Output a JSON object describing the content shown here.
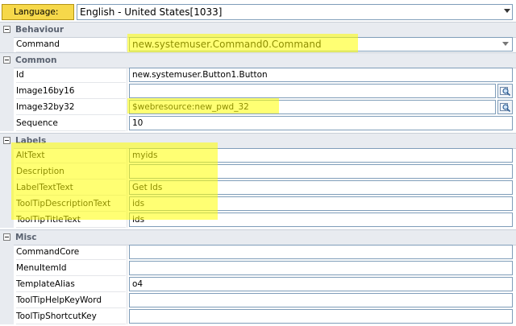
{
  "language": {
    "label": "Language:",
    "value": "English - United States[1033]"
  },
  "sections": {
    "behaviour": {
      "title": "Behaviour",
      "command": {
        "label": "Command",
        "value": "new.systemuser.Command0.Command"
      }
    },
    "common": {
      "title": "Common",
      "id": {
        "label": "Id",
        "value": "new.systemuser.Button1.Button"
      },
      "image16": {
        "label": "Image16by16",
        "value": ""
      },
      "image32": {
        "label": "Image32by32",
        "value": "$webresource:new_pwd_32"
      },
      "sequence": {
        "label": "Sequence",
        "value": "10"
      }
    },
    "labels": {
      "title": "Labels",
      "alttext": {
        "label": "AltText",
        "value": "myids"
      },
      "description": {
        "label": "Description",
        "value": ""
      },
      "labeltext": {
        "label": "LabelTextText",
        "value": "Get Ids"
      },
      "tooltipdesc": {
        "label": "ToolTipDescriptionText",
        "value": "ids"
      },
      "tooltiptitle": {
        "label": "ToolTipTitleText",
        "value": "ids"
      }
    },
    "misc": {
      "title": "Misc",
      "commandcore": {
        "label": "CommandCore",
        "value": ""
      },
      "menuitemid": {
        "label": "MenuItemId",
        "value": ""
      },
      "templatealias": {
        "label": "TemplateAlias",
        "value": "o4"
      },
      "helpkeyword": {
        "label": "ToolTipHelpKeyWord",
        "value": ""
      },
      "shortcutkey": {
        "label": "ToolTipShortcutKey",
        "value": ""
      }
    }
  },
  "colors": {
    "highlight": "#ffff00",
    "section_bg": "#e8ebf0",
    "field_border": "#7f9db9",
    "language_label_bg": "#f6d84a"
  },
  "icons": {
    "browse": "browse-magnifier-icon",
    "collapse": "collapse-minus-icon",
    "dropdown": "chevron-down-icon"
  }
}
